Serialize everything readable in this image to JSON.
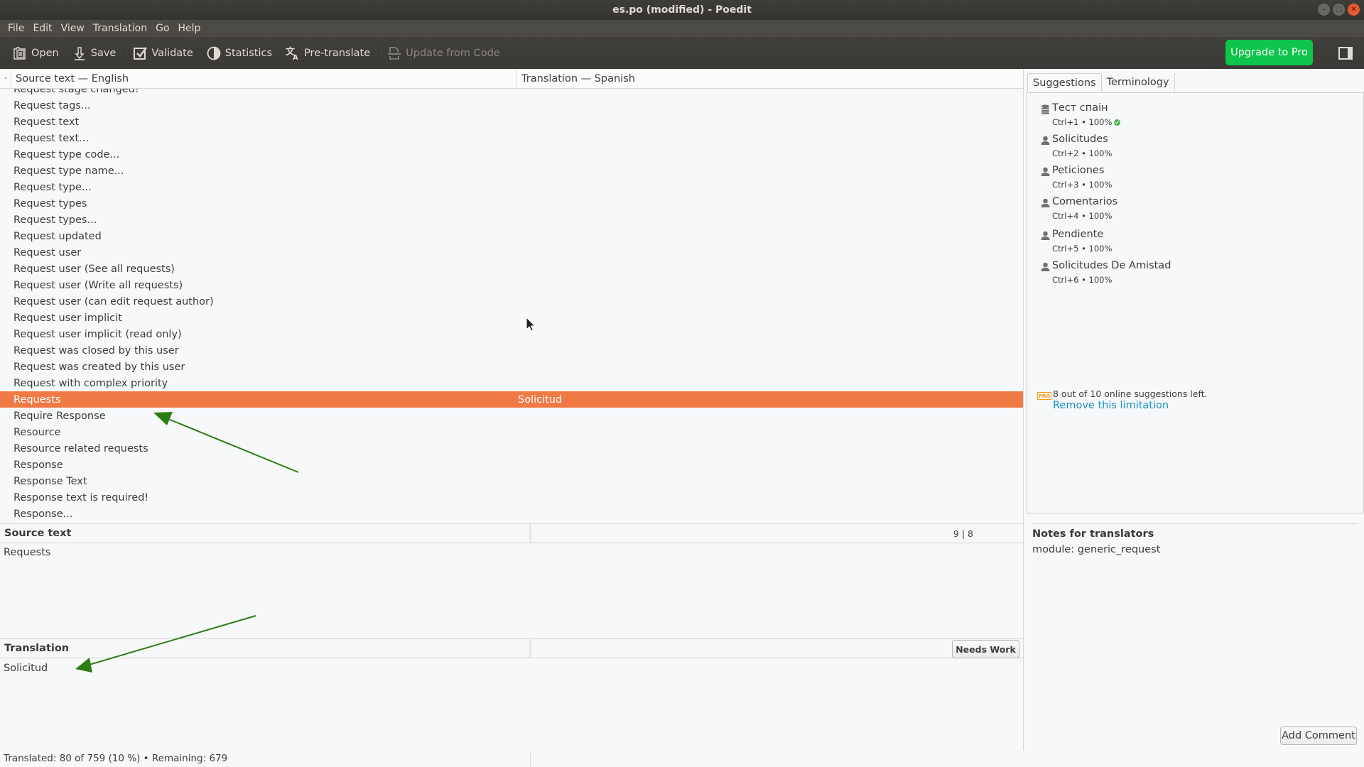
{
  "window": {
    "title": "es.po (modified) - Poedit",
    "controls": [
      "minimize",
      "maximize",
      "close"
    ]
  },
  "menu": [
    "File",
    "Edit",
    "View",
    "Translation",
    "Go",
    "Help"
  ],
  "toolbar": {
    "open": "Open",
    "save": "Save",
    "validate": "Validate",
    "statistics": "Statistics",
    "pretranslate": "Pre-translate",
    "update_from_code": "Update from Code",
    "upgrade": "Upgrade to Pro"
  },
  "list": {
    "header_source": "Source text — English",
    "header_translation": "Translation — Spanish",
    "rows": [
      {
        "source": "Request stage changed!",
        "translation": ""
      },
      {
        "source": "Request tags...",
        "translation": ""
      },
      {
        "source": "Request text",
        "translation": ""
      },
      {
        "source": "Request text...",
        "translation": ""
      },
      {
        "source": "Request type code...",
        "translation": ""
      },
      {
        "source": "Request type name...",
        "translation": ""
      },
      {
        "source": "Request type...",
        "translation": ""
      },
      {
        "source": "Request types",
        "translation": ""
      },
      {
        "source": "Request types...",
        "translation": ""
      },
      {
        "source": "Request updated",
        "translation": ""
      },
      {
        "source": "Request user",
        "translation": ""
      },
      {
        "source": "Request user (See all requests)",
        "translation": ""
      },
      {
        "source": "Request user (Write all requests)",
        "translation": ""
      },
      {
        "source": "Request user (can edit request author)",
        "translation": ""
      },
      {
        "source": "Request user implicit",
        "translation": ""
      },
      {
        "source": "Request user implicit (read only)",
        "translation": ""
      },
      {
        "source": "Request was closed by this user",
        "translation": ""
      },
      {
        "source": "Request was created by this user",
        "translation": ""
      },
      {
        "source": "Request with complex priority",
        "translation": ""
      },
      {
        "source": "Requests",
        "translation": "Solicitud",
        "selected": true
      },
      {
        "source": "Require Response",
        "translation": ""
      },
      {
        "source": "Resource",
        "translation": ""
      },
      {
        "source": "Resource related requests",
        "translation": ""
      },
      {
        "source": "Response",
        "translation": ""
      },
      {
        "source": "Response Text",
        "translation": ""
      },
      {
        "source": "Response text is required!",
        "translation": ""
      },
      {
        "source": "Response...",
        "translation": ""
      }
    ]
  },
  "editor": {
    "source_label": "Source text",
    "source_counter": "9 | 8",
    "source_text": "Requests",
    "translation_label": "Translation",
    "needs_work": "Needs Work",
    "translation_text": "Solicitud"
  },
  "sidebar": {
    "tabs": [
      "Suggestions",
      "Terminology"
    ],
    "active_tab": "Suggestions",
    "suggestions": [
      {
        "icon": "database-icon",
        "text": "Тест спаін",
        "shortcut": "Ctrl+1",
        "score": "100%",
        "verified": true
      },
      {
        "icon": "person-icon",
        "text": "Solicitudes",
        "shortcut": "Ctrl+2",
        "score": "100%"
      },
      {
        "icon": "person-icon",
        "text": "Peticiones",
        "shortcut": "Ctrl+3",
        "score": "100%"
      },
      {
        "icon": "person-icon",
        "text": "Comentarios",
        "shortcut": "Ctrl+4",
        "score": "100%"
      },
      {
        "icon": "person-icon",
        "text": "Pendiente",
        "shortcut": "Ctrl+5",
        "score": "100%"
      },
      {
        "icon": "person-icon",
        "text": "Solicitudes De Amistad",
        "shortcut": "Ctrl+6",
        "score": "100%"
      }
    ],
    "pro_badge": "PRO",
    "limit_text": "8 out of 10 online suggestions left.",
    "limit_link": "Remove this limitation",
    "notes_title": "Notes for translators",
    "notes_text": "module: generic_request",
    "add_comment": "Add Comment"
  },
  "status": {
    "text": "Translated: 80 of 759 (10 %)  •  Remaining: 679"
  },
  "colors": {
    "selection": "#ef7a46",
    "upgrade": "#0fc44b",
    "link": "#1a8cc1",
    "pro": "#f29b1f",
    "annotation_arrow": "#2e7d12"
  }
}
